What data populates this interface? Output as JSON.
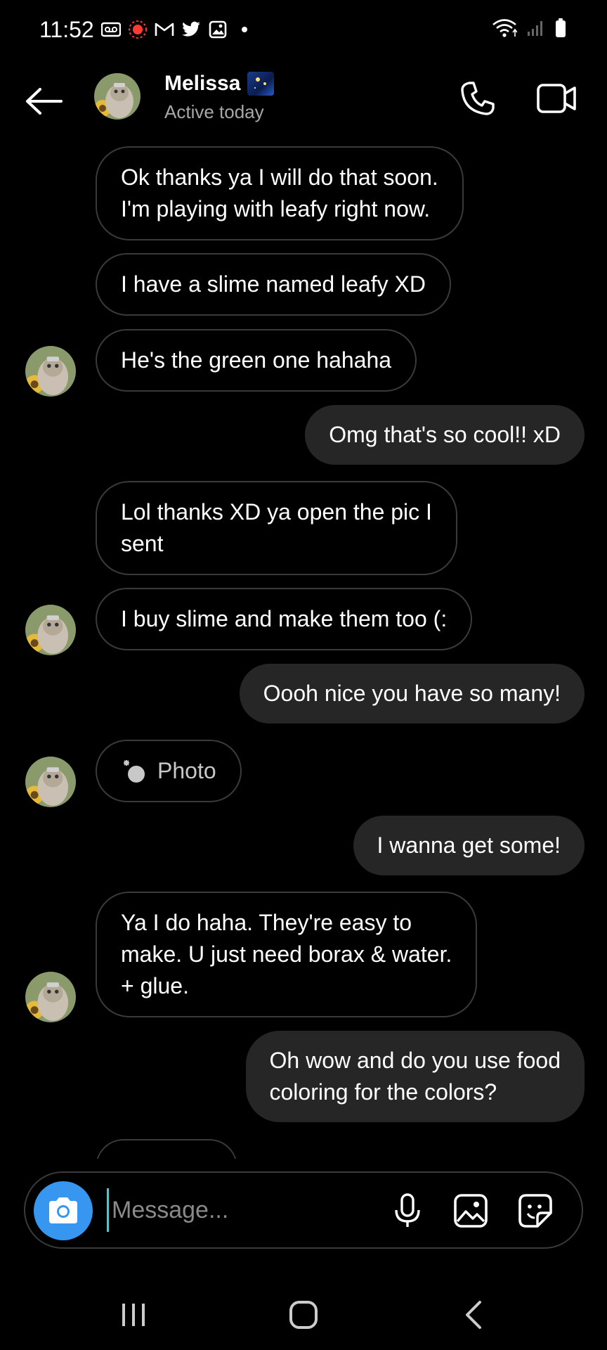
{
  "status_bar": {
    "time": "11:52",
    "left_icons": [
      "voicemail-icon",
      "recording-icon",
      "gmail-icon",
      "twitter-icon",
      "gallery-icon",
      "dot-icon"
    ],
    "right_icons": [
      "wifi-icon",
      "signal-icon",
      "battery-icon"
    ]
  },
  "header": {
    "contact_name": "Melissa",
    "contact_status": "Active today",
    "icons": {
      "back": "arrow-left-icon",
      "call": "phone-icon",
      "video": "video-camera-icon"
    }
  },
  "messages": [
    {
      "direction": "in",
      "text_lines": [
        "Ok thanks ya I will do that soon.",
        "I'm playing with leafy right now."
      ]
    },
    {
      "direction": "in",
      "text_lines": [
        "I have a slime named leafy XD"
      ]
    },
    {
      "direction": "in",
      "text_lines": [
        "He's the green one hahaha"
      ]
    },
    {
      "direction": "out",
      "text_lines": [
        "Omg that's so cool!! xD"
      ]
    },
    {
      "direction": "in",
      "text_lines": [
        "Lol thanks XD ya open the pic I",
        "sent"
      ]
    },
    {
      "direction": "in",
      "text_lines": [
        "I buy slime and make them too (:"
      ]
    },
    {
      "direction": "out",
      "text_lines": [
        "Oooh nice you have so many!"
      ]
    },
    {
      "direction": "in",
      "type": "photo",
      "text_lines": [
        "Photo"
      ]
    },
    {
      "direction": "out",
      "text_lines": [
        "I wanna get some!"
      ]
    },
    {
      "direction": "in",
      "text_lines": [
        "Ya I do haha. They're easy to",
        "make. U just need borax & water.",
        "+ glue."
      ]
    },
    {
      "direction": "out",
      "text_lines": [
        "Oh wow and do you use food",
        "coloring for the colors?"
      ]
    }
  ],
  "composer": {
    "placeholder": "Message...",
    "value": "",
    "icons": {
      "camera": "camera-icon",
      "mic": "microphone-icon",
      "gallery": "image-icon",
      "sticker": "sticker-icon"
    }
  },
  "colors": {
    "background": "#000000",
    "incoming_border": "#3a3a3a",
    "outgoing_bubble": "#262626",
    "camera_button": "#3797f0",
    "secondary_text": "#a8a8a8"
  },
  "navbar": {
    "icons": [
      "recent-apps-icon",
      "home-icon",
      "back-icon"
    ]
  }
}
